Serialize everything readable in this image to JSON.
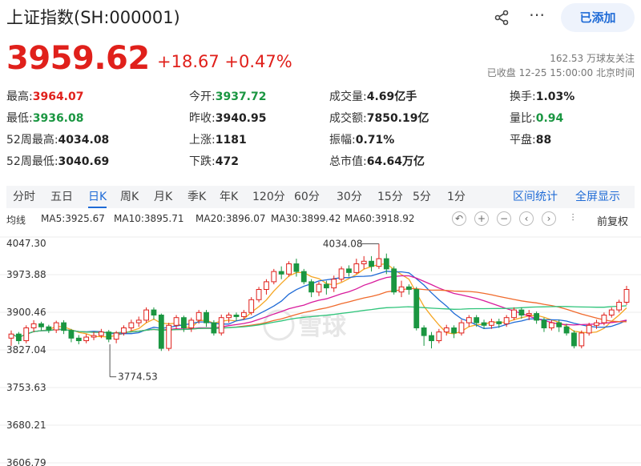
{
  "header": {
    "title": "上证指数(SH:000001)",
    "share_icon": "share-icon",
    "more_icon": "more-icon",
    "added_label": "已添加"
  },
  "quote": {
    "price": "3959.62",
    "change": "+18.67",
    "change_pct": "+0.47%",
    "follow": "162.53 万球友关注",
    "status": "已收盘 12-25 15:00:00 北京时间"
  },
  "stats": [
    {
      "label": "最高:",
      "value": "3964.07",
      "tone": "red"
    },
    {
      "label": "今开:",
      "value": "3937.72",
      "tone": "green"
    },
    {
      "label": "成交量:",
      "value": "4.69亿手",
      "tone": ""
    },
    {
      "label": "换手:",
      "value": "1.03%",
      "tone": ""
    },
    {
      "label": "最低:",
      "value": "3936.08",
      "tone": "green"
    },
    {
      "label": "昨收:",
      "value": "3940.95",
      "tone": ""
    },
    {
      "label": "成交额:",
      "value": "7850.19亿",
      "tone": ""
    },
    {
      "label": "量比:",
      "value": "0.94",
      "tone": "green"
    },
    {
      "label": "52周最高:",
      "value": "4034.08",
      "tone": ""
    },
    {
      "label": "上涨:",
      "value": "1181",
      "tone": ""
    },
    {
      "label": "振幅:",
      "value": "0.71%",
      "tone": ""
    },
    {
      "label": "平盘:",
      "value": "88",
      "tone": ""
    },
    {
      "label": "52周最低:",
      "value": "3040.69",
      "tone": ""
    },
    {
      "label": "下跌:",
      "value": "472",
      "tone": ""
    },
    {
      "label": "总市值:",
      "value": "64.64万亿",
      "tone": ""
    }
  ],
  "tabs": [
    "分时",
    "五日",
    "日K",
    "周K",
    "月K",
    "季K",
    "年K",
    "120分",
    "60分",
    "30分",
    "15分",
    "5分",
    "1分"
  ],
  "tab_active": "日K",
  "tab_links": [
    "区间统计",
    "全屏显示"
  ],
  "ma": {
    "avg_label": "均线",
    "items": [
      {
        "text": "MA5:3925.67",
        "color": "#f5a623"
      },
      {
        "text": "MA10:3895.71",
        "color": "#1f6bd6"
      },
      {
        "text": "MA20:3896.07",
        "color": "#d81b9c"
      },
      {
        "text": "MA30:3899.42",
        "color": "#f06a2c"
      },
      {
        "text": "MA60:3918.92",
        "color": "#2ec47a"
      }
    ],
    "controls": [
      "undo-icon",
      "zoom-in-icon",
      "zoom-out-icon",
      "scroll-left-icon",
      "scroll-right-icon",
      "candle-setting-icon"
    ],
    "adjust_label": "前复权"
  },
  "chart_data": {
    "type": "candlestick",
    "y_ticks": [
      "4047.30",
      "3973.88",
      "3900.46",
      "3827.04",
      "3753.63",
      "3680.21",
      "3606.79"
    ],
    "annotations": {
      "high": "4034.08",
      "low": "3774.53"
    },
    "watermark": "雪球",
    "candles": [
      [
        3850,
        3858,
        3835,
        3865
      ],
      [
        3858,
        3845,
        3838,
        3862
      ],
      [
        3845,
        3870,
        3840,
        3875
      ],
      [
        3870,
        3878,
        3862,
        3885
      ],
      [
        3878,
        3872,
        3865,
        3882
      ],
      [
        3872,
        3866,
        3860,
        3876
      ],
      [
        3866,
        3880,
        3860,
        3884
      ],
      [
        3880,
        3865,
        3858,
        3885
      ],
      [
        3865,
        3850,
        3842,
        3868
      ],
      [
        3850,
        3845,
        3838,
        3856
      ],
      [
        3845,
        3852,
        3840,
        3858
      ],
      [
        3852,
        3855,
        3846,
        3862
      ],
      [
        3855,
        3862,
        3850,
        3868
      ],
      [
        3862,
        3848,
        3842,
        3866
      ],
      [
        3848,
        3860,
        3840,
        3864
      ],
      [
        3860,
        3870,
        3855,
        3875
      ],
      [
        3870,
        3880,
        3864,
        3886
      ],
      [
        3880,
        3885,
        3872,
        3892
      ],
      [
        3885,
        3905,
        3880,
        3910
      ],
      [
        3905,
        3895,
        3886,
        3910
      ],
      [
        3895,
        3830,
        3825,
        3898
      ],
      [
        3830,
        3875,
        3825,
        3880
      ],
      [
        3875,
        3890,
        3868,
        3895
      ],
      [
        3890,
        3870,
        3862,
        3894
      ],
      [
        3870,
        3885,
        3862,
        3890
      ],
      [
        3885,
        3900,
        3878,
        3905
      ],
      [
        3900,
        3880,
        3872,
        3905
      ],
      [
        3880,
        3860,
        3855,
        3885
      ],
      [
        3860,
        3890,
        3855,
        3896
      ],
      [
        3890,
        3895,
        3880,
        3900
      ],
      [
        3895,
        3892,
        3884,
        3900
      ],
      [
        3892,
        3900,
        3886,
        3905
      ],
      [
        3900,
        3925,
        3895,
        3930
      ],
      [
        3925,
        3945,
        3920,
        3950
      ],
      [
        3945,
        3960,
        3935,
        3965
      ],
      [
        3960,
        3980,
        3955,
        3985
      ],
      [
        3980,
        3975,
        3965,
        3990
      ],
      [
        3975,
        3995,
        3970,
        4000
      ],
      [
        3995,
        3980,
        3970,
        4005
      ],
      [
        3980,
        3960,
        3955,
        3985
      ],
      [
        3960,
        3940,
        3930,
        3965
      ],
      [
        3940,
        3955,
        3932,
        3960
      ],
      [
        3955,
        3948,
        3935,
        3962
      ],
      [
        3948,
        3965,
        3940,
        3972
      ],
      [
        3965,
        3985,
        3960,
        3990
      ],
      [
        3985,
        3978,
        3970,
        3992
      ],
      [
        3978,
        3995,
        3975,
        4005
      ],
      [
        3995,
        4000,
        3985,
        4010
      ],
      [
        4000,
        3990,
        3980,
        4010
      ],
      [
        3990,
        4005,
        3985,
        4034
      ],
      [
        4005,
        3985,
        3975,
        4015
      ],
      [
        3985,
        3940,
        3935,
        3990
      ],
      [
        3940,
        3950,
        3930,
        3962
      ],
      [
        3950,
        3945,
        3935,
        3955
      ],
      [
        3945,
        3870,
        3865,
        3950
      ],
      [
        3870,
        3855,
        3835,
        3875
      ],
      [
        3855,
        3845,
        3830,
        3862
      ],
      [
        3845,
        3862,
        3840,
        3868
      ],
      [
        3862,
        3870,
        3855,
        3876
      ],
      [
        3870,
        3860,
        3850,
        3875
      ],
      [
        3860,
        3880,
        3855,
        3886
      ],
      [
        3880,
        3890,
        3872,
        3895
      ],
      [
        3890,
        3880,
        3872,
        3895
      ],
      [
        3880,
        3875,
        3868,
        3886
      ],
      [
        3875,
        3882,
        3868,
        3888
      ],
      [
        3882,
        3878,
        3870,
        3888
      ],
      [
        3878,
        3890,
        3872,
        3895
      ],
      [
        3890,
        3905,
        3885,
        3910
      ],
      [
        3905,
        3895,
        3888,
        3910
      ],
      [
        3895,
        3898,
        3885,
        3905
      ],
      [
        3898,
        3885,
        3878,
        3902
      ],
      [
        3885,
        3870,
        3862,
        3890
      ],
      [
        3870,
        3880,
        3865,
        3885
      ],
      [
        3880,
        3872,
        3862,
        3886
      ],
      [
        3872,
        3860,
        3855,
        3878
      ],
      [
        3860,
        3835,
        3830,
        3865
      ],
      [
        3835,
        3860,
        3830,
        3865
      ],
      [
        3860,
        3875,
        3855,
        3880
      ],
      [
        3875,
        3880,
        3868,
        3886
      ],
      [
        3880,
        3895,
        3875,
        3900
      ],
      [
        3895,
        3905,
        3890,
        3910
      ],
      [
        3905,
        3920,
        3900,
        3925
      ],
      [
        3920,
        3945,
        3915,
        3952
      ]
    ]
  }
}
